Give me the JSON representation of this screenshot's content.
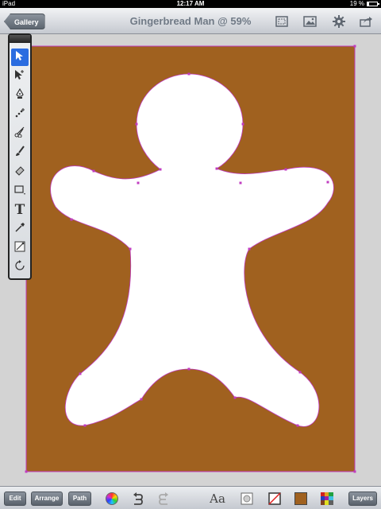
{
  "status_bar": {
    "device": "iPad",
    "time": "12:17 AM",
    "battery_text": "19 %",
    "battery_level": 0.19
  },
  "toolbar": {
    "gallery_label": "Gallery",
    "document_title": "Gingerbread Man @ 59%",
    "icons": [
      "fit-screen-icon",
      "image-icon",
      "gear-icon",
      "share-icon"
    ]
  },
  "tools": [
    {
      "name": "select-tool",
      "icon": "arrow-icon",
      "active": true
    },
    {
      "name": "node-tool",
      "icon": "node-arrow-icon",
      "active": false
    },
    {
      "name": "pen-tool",
      "icon": "pen-nib-icon",
      "active": false
    },
    {
      "name": "add-anchor-tool",
      "icon": "add-anchor-icon",
      "active": false
    },
    {
      "name": "scissors-tool",
      "icon": "scissors-icon",
      "active": false
    },
    {
      "name": "brush-tool",
      "icon": "brush-icon",
      "active": false
    },
    {
      "name": "eraser-tool",
      "icon": "eraser-icon",
      "active": false
    },
    {
      "name": "shape-tool",
      "icon": "rectangle-icon",
      "active": false
    },
    {
      "name": "text-tool",
      "icon": "text-t-icon",
      "active": false,
      "label": "T"
    },
    {
      "name": "eyedropper-tool",
      "icon": "eyedropper-icon",
      "active": false
    },
    {
      "name": "gradient-tool",
      "icon": "gradient-icon",
      "active": false
    },
    {
      "name": "rotate-tool",
      "icon": "rotate-icon",
      "active": false
    }
  ],
  "artwork": {
    "background_color": "#a0611f",
    "figure_color": "#ffffff",
    "anchor_color": "#c03cc0"
  },
  "bottom_bar": {
    "edit_label": "Edit",
    "arrange_label": "Arrange",
    "path_label": "Path",
    "font_label": "Aa",
    "layers_label": "Layers",
    "fill_color": "#a0611f"
  }
}
